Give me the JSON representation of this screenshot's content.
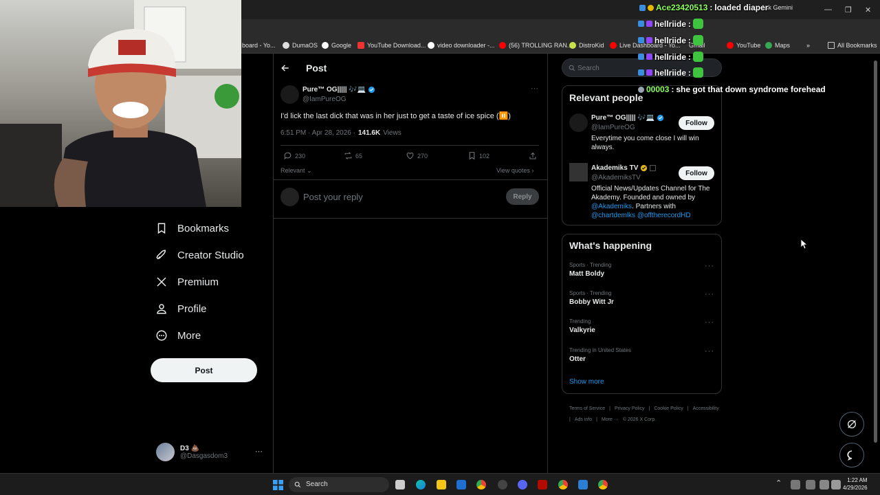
{
  "browser": {
    "ask_gemini": "Ask Gemini",
    "bookmarks": [
      {
        "label": "board - Yo..."
      },
      {
        "label": "DumaOS"
      },
      {
        "label": "Google"
      },
      {
        "label": "YouTube Download..."
      },
      {
        "label": "video downloader -..."
      },
      {
        "label": "(56) TROLLING RAN..."
      },
      {
        "label": "DistroKid"
      },
      {
        "label": "Live Dashboard - Yo..."
      },
      {
        "label": "Gmail"
      },
      {
        "label": "YouTube"
      },
      {
        "label": "Maps"
      }
    ],
    "more_bookmarks": "»",
    "all_bookmarks": "All Bookmarks"
  },
  "nav": {
    "bookmarks": "Bookmarks",
    "creator_studio": "Creator Studio",
    "premium": "Premium",
    "profile": "Profile",
    "more": "More",
    "post_button": "Post",
    "account_name": "D3 💩",
    "account_handle": "@Dasgasdom3",
    "account_more": "···"
  },
  "post": {
    "header": "Post",
    "author_name": "Pure™ OG||||| 🎶💻",
    "author_handle": "@IamPureOG",
    "text": "I'd lick the last dick that was in her just to get a taste of ice spice (⏸️)",
    "time": "6:51 PM · Apr 28, 2026 ·",
    "views_count": "141.6K",
    "views_label": "Views",
    "replies": "230",
    "reposts": "65",
    "likes": "270",
    "bookmarks": "102",
    "sort": "Relevant",
    "view_quotes": "View quotes",
    "reply_placeholder": "Post your reply",
    "reply_button": "Reply",
    "more": "···"
  },
  "sidebar": {
    "search_placeholder": "Search",
    "relevant_title": "Relevant people",
    "people": [
      {
        "name": "Pure™ OG||||| 🎶💻",
        "handle": "@IamPureOG",
        "follow": "Follow",
        "bio": "Everytime you come close I will win always."
      },
      {
        "name": "Akademiks TV",
        "handle": "@AkademiksTV",
        "follow": "Follow",
        "bio": "Official News/Updates Channel for The Akademy. Founded and owned by",
        "mention1": "@Akademiks",
        "bio2": ". Partners with",
        "mention2": "@chartdemlks",
        "mention3": "@offtherecordHD"
      }
    ],
    "happening_title": "What's happening",
    "trends": [
      {
        "meta": "Sports · Trending",
        "name": "Matt Boldy"
      },
      {
        "meta": "Sports · Trending",
        "name": "Bobby Witt Jr"
      },
      {
        "meta": "Trending",
        "name": "Valkyrie"
      },
      {
        "meta": "Trending in United States",
        "name": "Otter"
      }
    ],
    "show_more": "Show more",
    "footer": [
      "Terms of Service",
      "|",
      "Privacy Policy",
      "|",
      "Cookie Policy",
      "|",
      "Accessibility",
      "|",
      "Ads info",
      "|",
      "More ···",
      "© 2026 X Corp."
    ]
  },
  "chat": [
    {
      "user": "Ace23420513",
      "message": "loaded diaper"
    },
    {
      "user": "hellriide",
      "message": ""
    },
    {
      "user": "hellriide",
      "message": ""
    },
    {
      "user": "hellriide",
      "message": ""
    },
    {
      "user": "hellriide",
      "message": ""
    },
    {
      "user": "00003",
      "message": "she got that down syndrome forehead"
    }
  ],
  "taskbar": {
    "search": "Search",
    "time": "1:22 AM",
    "date": "4/29/2026"
  },
  "colors": {
    "background": "#000000",
    "accent": "#1d9bf0",
    "chat_user": "#8bff5a",
    "muted": "#71767b"
  }
}
